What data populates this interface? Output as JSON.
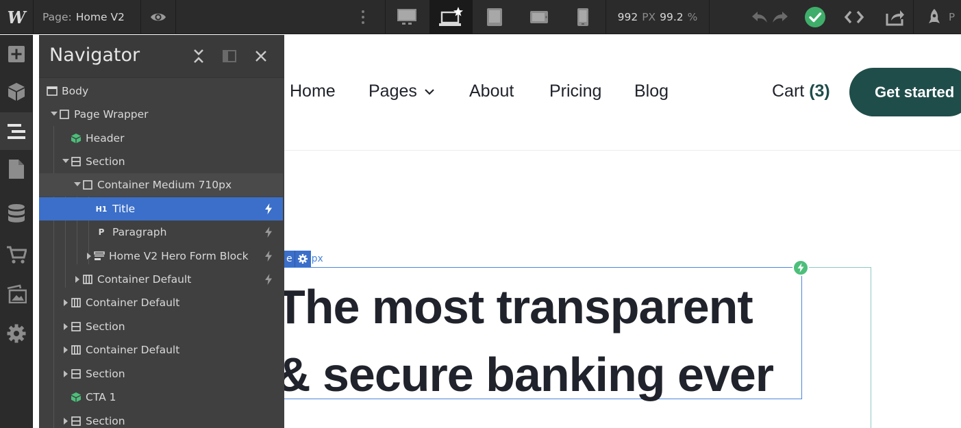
{
  "topbar": {
    "logo_text": "W",
    "page_prefix": "Page:",
    "page_name": "Home V2",
    "canvas_width_value": "992",
    "canvas_width_unit": "PX",
    "zoom_value": "99.2",
    "zoom_unit": "%",
    "publish_label_partial": "P",
    "icons": [
      "preview-eye-icon",
      "more-dots-icon",
      "desktop-icon",
      "laptop-star-icon",
      "tablet-icon",
      "tablet-landscape-icon",
      "phone-icon",
      "undo-icon",
      "redo-icon",
      "check-status-icon",
      "code-icon",
      "export-icon",
      "rocket-icon"
    ],
    "status_color": "#3fae6a"
  },
  "leftrail": {
    "icons": [
      "add-icon",
      "components-icon",
      "navigator-icon",
      "pages-icon",
      "cms-icon",
      "ecommerce-icon",
      "assets-icon",
      "settings-icon"
    ],
    "active": "navigator-icon"
  },
  "navigator": {
    "title": "Navigator",
    "tree": [
      {
        "label": "Body",
        "icon": "body-icon"
      },
      {
        "label": "Page Wrapper",
        "icon": "div-icon"
      },
      {
        "label": "Header",
        "icon": "symbol-icon"
      },
      {
        "label": "Section",
        "icon": "section-icon"
      },
      {
        "label": "Container Medium 710px",
        "icon": "div-icon"
      },
      {
        "label": "Title",
        "icon": "heading-icon",
        "icon_text": "H1",
        "selected": true
      },
      {
        "label": "Paragraph",
        "icon": "paragraph-icon",
        "icon_text": "P"
      },
      {
        "label": "Home V2 Hero Form Block",
        "icon": "form-icon"
      },
      {
        "label": "Container Default",
        "icon": "container-icon"
      },
      {
        "label": "Container Default",
        "icon": "container-icon"
      },
      {
        "label": "Section",
        "icon": "section-icon"
      },
      {
        "label": "Container Default",
        "icon": "container-icon"
      },
      {
        "label": "Section",
        "icon": "section-icon"
      },
      {
        "label": "CTA 1",
        "icon": "symbol-icon"
      },
      {
        "label": "Section",
        "icon": "section-icon"
      }
    ]
  },
  "canvas": {
    "nav_links": [
      "Home",
      "Pages",
      "About",
      "Pricing",
      "Blog"
    ],
    "cart_label": "Cart",
    "cart_count": "(3)",
    "cta_label": "Get started",
    "title_tag_name": "e",
    "title_tag_width": "px",
    "hero_line1": "The most transparent",
    "hero_line2": "& secure banking ever",
    "brand_color": "#1f4d4a",
    "selection_color": "#3b6fc9"
  }
}
